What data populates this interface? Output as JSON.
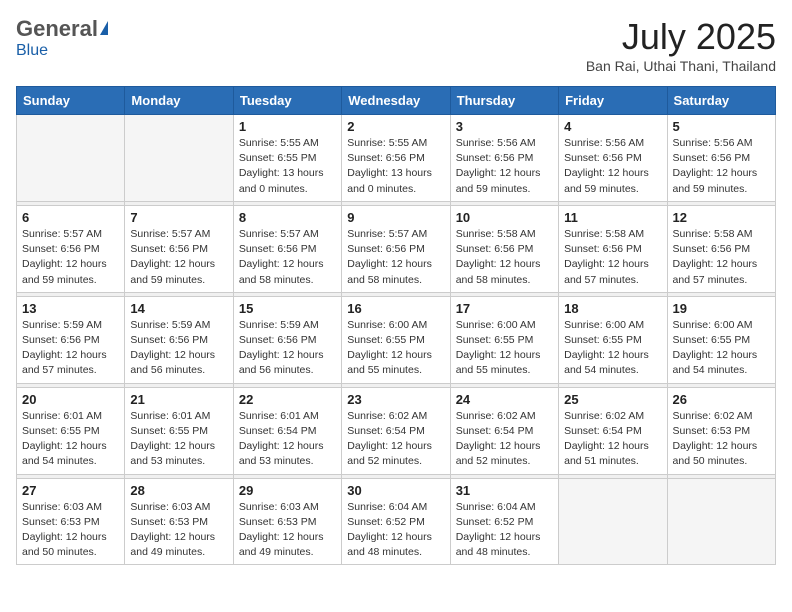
{
  "header": {
    "logo_general": "General",
    "logo_blue": "Blue",
    "title": "July 2025",
    "location": "Ban Rai, Uthai Thani, Thailand"
  },
  "days_of_week": [
    "Sunday",
    "Monday",
    "Tuesday",
    "Wednesday",
    "Thursday",
    "Friday",
    "Saturday"
  ],
  "weeks": [
    [
      {
        "day": null,
        "info": null
      },
      {
        "day": null,
        "info": null
      },
      {
        "day": "1",
        "info": "Sunrise: 5:55 AM\nSunset: 6:55 PM\nDaylight: 13 hours\nand 0 minutes."
      },
      {
        "day": "2",
        "info": "Sunrise: 5:55 AM\nSunset: 6:56 PM\nDaylight: 13 hours\nand 0 minutes."
      },
      {
        "day": "3",
        "info": "Sunrise: 5:56 AM\nSunset: 6:56 PM\nDaylight: 12 hours\nand 59 minutes."
      },
      {
        "day": "4",
        "info": "Sunrise: 5:56 AM\nSunset: 6:56 PM\nDaylight: 12 hours\nand 59 minutes."
      },
      {
        "day": "5",
        "info": "Sunrise: 5:56 AM\nSunset: 6:56 PM\nDaylight: 12 hours\nand 59 minutes."
      }
    ],
    [
      {
        "day": "6",
        "info": "Sunrise: 5:57 AM\nSunset: 6:56 PM\nDaylight: 12 hours\nand 59 minutes."
      },
      {
        "day": "7",
        "info": "Sunrise: 5:57 AM\nSunset: 6:56 PM\nDaylight: 12 hours\nand 59 minutes."
      },
      {
        "day": "8",
        "info": "Sunrise: 5:57 AM\nSunset: 6:56 PM\nDaylight: 12 hours\nand 58 minutes."
      },
      {
        "day": "9",
        "info": "Sunrise: 5:57 AM\nSunset: 6:56 PM\nDaylight: 12 hours\nand 58 minutes."
      },
      {
        "day": "10",
        "info": "Sunrise: 5:58 AM\nSunset: 6:56 PM\nDaylight: 12 hours\nand 58 minutes."
      },
      {
        "day": "11",
        "info": "Sunrise: 5:58 AM\nSunset: 6:56 PM\nDaylight: 12 hours\nand 57 minutes."
      },
      {
        "day": "12",
        "info": "Sunrise: 5:58 AM\nSunset: 6:56 PM\nDaylight: 12 hours\nand 57 minutes."
      }
    ],
    [
      {
        "day": "13",
        "info": "Sunrise: 5:59 AM\nSunset: 6:56 PM\nDaylight: 12 hours\nand 57 minutes."
      },
      {
        "day": "14",
        "info": "Sunrise: 5:59 AM\nSunset: 6:56 PM\nDaylight: 12 hours\nand 56 minutes."
      },
      {
        "day": "15",
        "info": "Sunrise: 5:59 AM\nSunset: 6:56 PM\nDaylight: 12 hours\nand 56 minutes."
      },
      {
        "day": "16",
        "info": "Sunrise: 6:00 AM\nSunset: 6:55 PM\nDaylight: 12 hours\nand 55 minutes."
      },
      {
        "day": "17",
        "info": "Sunrise: 6:00 AM\nSunset: 6:55 PM\nDaylight: 12 hours\nand 55 minutes."
      },
      {
        "day": "18",
        "info": "Sunrise: 6:00 AM\nSunset: 6:55 PM\nDaylight: 12 hours\nand 54 minutes."
      },
      {
        "day": "19",
        "info": "Sunrise: 6:00 AM\nSunset: 6:55 PM\nDaylight: 12 hours\nand 54 minutes."
      }
    ],
    [
      {
        "day": "20",
        "info": "Sunrise: 6:01 AM\nSunset: 6:55 PM\nDaylight: 12 hours\nand 54 minutes."
      },
      {
        "day": "21",
        "info": "Sunrise: 6:01 AM\nSunset: 6:55 PM\nDaylight: 12 hours\nand 53 minutes."
      },
      {
        "day": "22",
        "info": "Sunrise: 6:01 AM\nSunset: 6:54 PM\nDaylight: 12 hours\nand 53 minutes."
      },
      {
        "day": "23",
        "info": "Sunrise: 6:02 AM\nSunset: 6:54 PM\nDaylight: 12 hours\nand 52 minutes."
      },
      {
        "day": "24",
        "info": "Sunrise: 6:02 AM\nSunset: 6:54 PM\nDaylight: 12 hours\nand 52 minutes."
      },
      {
        "day": "25",
        "info": "Sunrise: 6:02 AM\nSunset: 6:54 PM\nDaylight: 12 hours\nand 51 minutes."
      },
      {
        "day": "26",
        "info": "Sunrise: 6:02 AM\nSunset: 6:53 PM\nDaylight: 12 hours\nand 50 minutes."
      }
    ],
    [
      {
        "day": "27",
        "info": "Sunrise: 6:03 AM\nSunset: 6:53 PM\nDaylight: 12 hours\nand 50 minutes."
      },
      {
        "day": "28",
        "info": "Sunrise: 6:03 AM\nSunset: 6:53 PM\nDaylight: 12 hours\nand 49 minutes."
      },
      {
        "day": "29",
        "info": "Sunrise: 6:03 AM\nSunset: 6:53 PM\nDaylight: 12 hours\nand 49 minutes."
      },
      {
        "day": "30",
        "info": "Sunrise: 6:04 AM\nSunset: 6:52 PM\nDaylight: 12 hours\nand 48 minutes."
      },
      {
        "day": "31",
        "info": "Sunrise: 6:04 AM\nSunset: 6:52 PM\nDaylight: 12 hours\nand 48 minutes."
      },
      {
        "day": null,
        "info": null
      },
      {
        "day": null,
        "info": null
      }
    ]
  ]
}
